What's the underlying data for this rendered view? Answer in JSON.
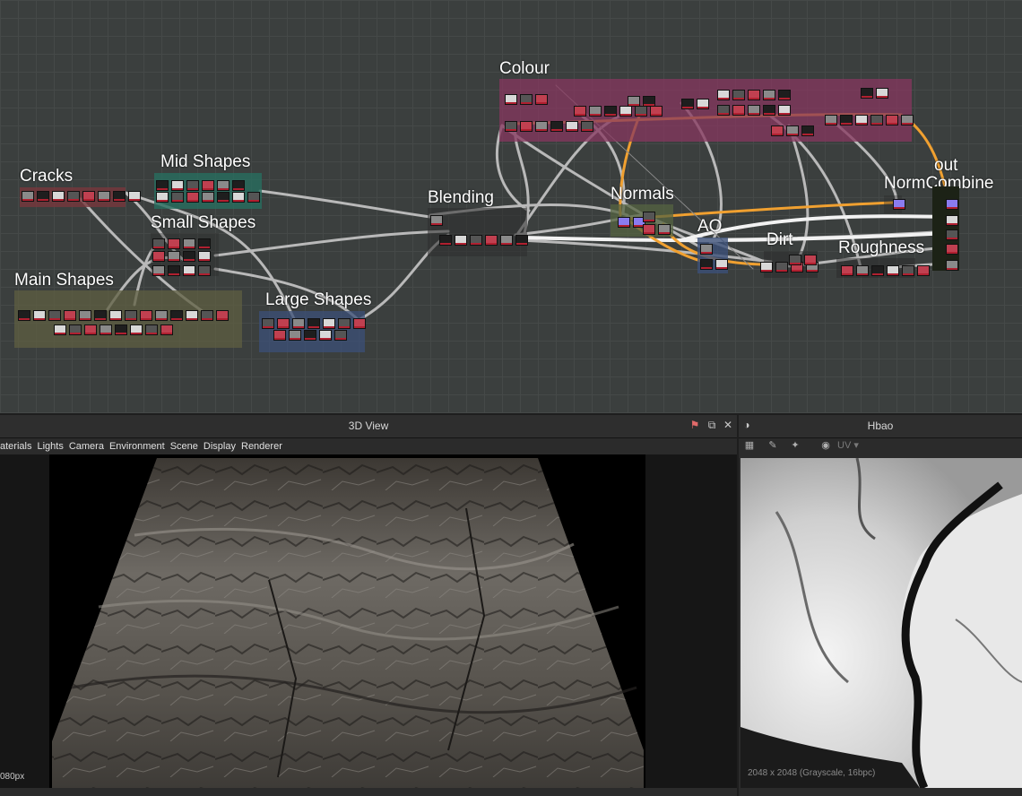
{
  "graph": {
    "frames": {
      "colour": "Colour",
      "cracks": "Cracks",
      "mid_shapes": "Mid Shapes",
      "small_shapes": "Small Shapes",
      "main_shapes": "Main Shapes",
      "large_shapes": "Large Shapes",
      "blending": "Blending",
      "normals": "Normals",
      "ao": "AO",
      "dirt": "Dirt",
      "roughness": "Roughness",
      "norm_combine": "NormCombine",
      "out": "out"
    }
  },
  "view3d": {
    "title": "3D View",
    "menu": [
      "aterials",
      "Lights",
      "Camera",
      "Environment",
      "Scene",
      "Display",
      "Renderer"
    ],
    "resolution_label": "080px"
  },
  "view2d": {
    "title": "Hbao",
    "uv_label": "UV",
    "status": "2048 x 2048 (Grayscale, 16bpc)"
  },
  "colors": {
    "graph_bg": "#3b3f3e",
    "colour_frame": "#7a3a5a",
    "cracks_frame": "#6a3a3e",
    "mid_frame": "#2f6a5c",
    "main_frame": "#5a5a40",
    "large_frame": "#3a4a6e",
    "normals_frame": "#4e5a3e",
    "ao_frame": "#3a4a6e",
    "orange_wire": "#f0a030"
  },
  "icons": [
    "pin-icon",
    "restore-icon",
    "close-icon",
    "light-icon",
    "camera-icon",
    "export-icon",
    "target-icon",
    "snapshot-icon"
  ]
}
